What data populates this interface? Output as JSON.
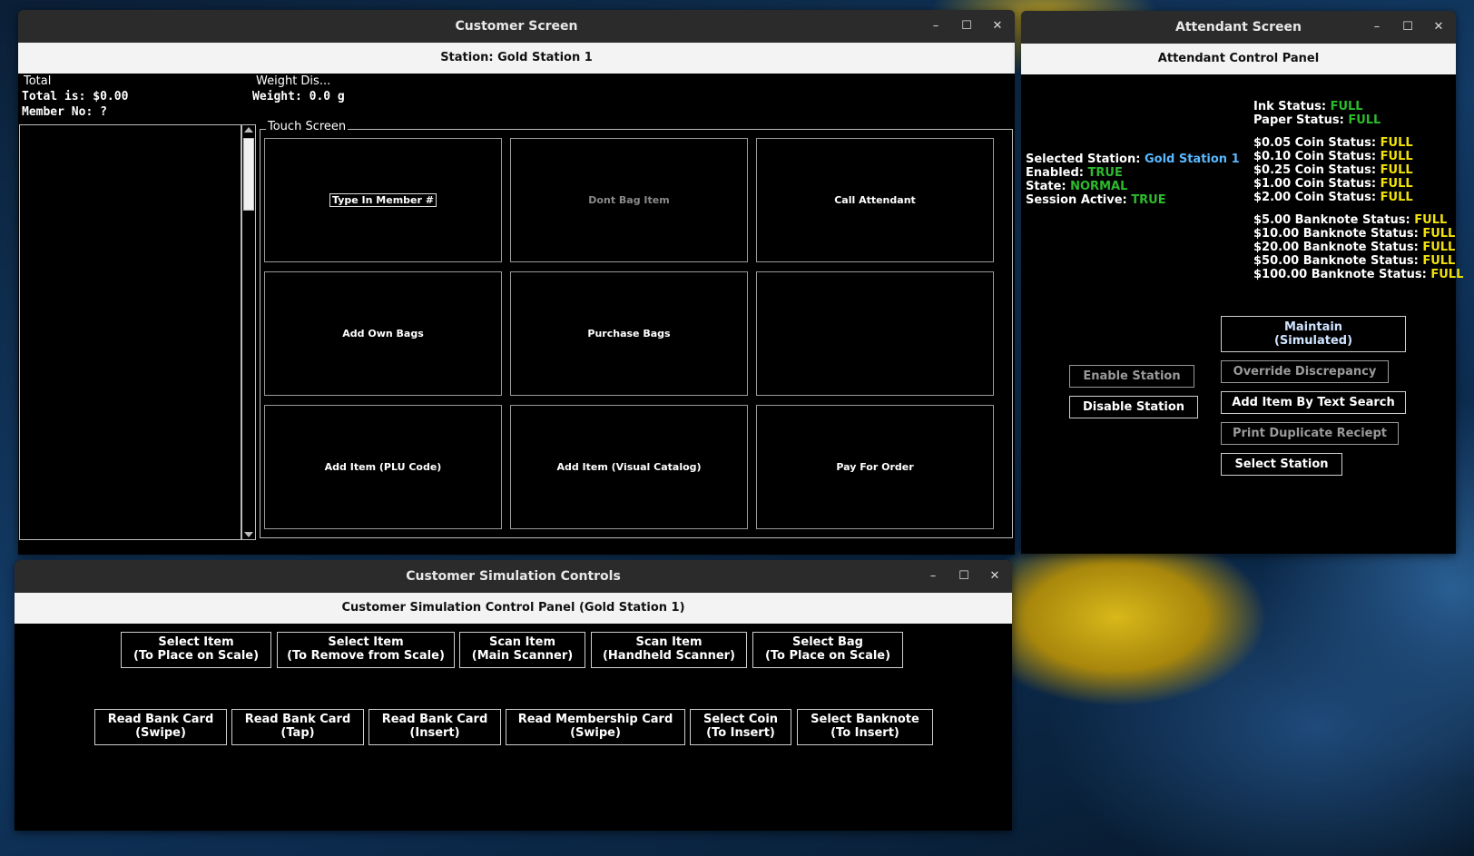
{
  "customer_screen": {
    "window_title": "Customer Screen",
    "station_header": "Station: Gold Station 1",
    "total_title": "Total",
    "total_text": "Total is: $0.00",
    "member_text": "Member No: ?",
    "weight_title": "Weight Dis...",
    "weight_text": "Weight: 0.0 g",
    "touch_title": "Touch Screen",
    "buttons": [
      "Type In Member #",
      "Dont Bag Item",
      "Call Attendant",
      "Add Own Bags",
      "Purchase Bags",
      "",
      "Add Item (PLU Code)",
      "Add Item (Visual Catalog)",
      "Pay For Order"
    ]
  },
  "attendant_screen": {
    "window_title": "Attendant Screen",
    "panel_header": "Attendant Control Panel",
    "selected_station_label": "Selected Station:",
    "selected_station_value": "Gold Station 1",
    "enabled_label": "Enabled:",
    "enabled_value": "TRUE",
    "state_label": "State:",
    "state_value": "NORMAL",
    "session_label": "Session Active:",
    "session_value": "TRUE",
    "ink_label": "Ink Status:",
    "ink_value": "FULL",
    "paper_label": "Paper Status:",
    "paper_value": "FULL",
    "coins": [
      {
        "label": "$0.05 Coin Status:",
        "value": "FULL"
      },
      {
        "label": "$0.10 Coin Status:",
        "value": "FULL"
      },
      {
        "label": "$0.25 Coin Status:",
        "value": "FULL"
      },
      {
        "label": "$1.00 Coin Status:",
        "value": "FULL"
      },
      {
        "label": "$2.00 Coin Status:",
        "value": "FULL"
      }
    ],
    "banknotes": [
      {
        "label": "$5.00 Banknote Status:",
        "value": "FULL"
      },
      {
        "label": "$10.00 Banknote Status:",
        "value": "FULL"
      },
      {
        "label": "$20.00 Banknote Status:",
        "value": "FULL"
      },
      {
        "label": "$50.00 Banknote Status:",
        "value": "FULL"
      },
      {
        "label": "$100.00 Banknote Status:",
        "value": "FULL"
      }
    ],
    "maintain_line1": "Maintain",
    "maintain_line2": "(Simulated)",
    "enable_station": "Enable Station",
    "disable_station": "Disable Station",
    "override_discrepancy": "Override Discrepancy",
    "add_item_text_search": "Add Item By Text Search",
    "print_duplicate": "Print Duplicate Reciept",
    "select_station": "Select Station"
  },
  "simulation": {
    "window_title": "Customer Simulation Controls",
    "panel_header": "Customer Simulation Control Panel (Gold Station 1)",
    "row1": [
      {
        "line1": "Select Item",
        "line2": "(To Place on Scale)"
      },
      {
        "line1": "Select Item",
        "line2": "(To Remove from Scale)"
      },
      {
        "line1": "Scan Item",
        "line2": "(Main Scanner)"
      },
      {
        "line1": "Scan Item",
        "line2": "(Handheld Scanner)"
      },
      {
        "line1": "Select Bag",
        "line2": "(To Place on Scale)"
      }
    ],
    "row2": [
      {
        "line1": "Read Bank Card",
        "line2": "(Swipe)"
      },
      {
        "line1": "Read Bank Card",
        "line2": "(Tap)"
      },
      {
        "line1": "Read Bank Card",
        "line2": "(Insert)"
      },
      {
        "line1": "Read Membership Card",
        "line2": "(Swipe)"
      },
      {
        "line1": "Select Coin",
        "line2": "(To Insert)"
      },
      {
        "line1": "Select Banknote",
        "line2": "(To Insert)"
      }
    ]
  },
  "window_controls": {
    "minimize": "–",
    "maximize": "☐",
    "close": "✕"
  }
}
